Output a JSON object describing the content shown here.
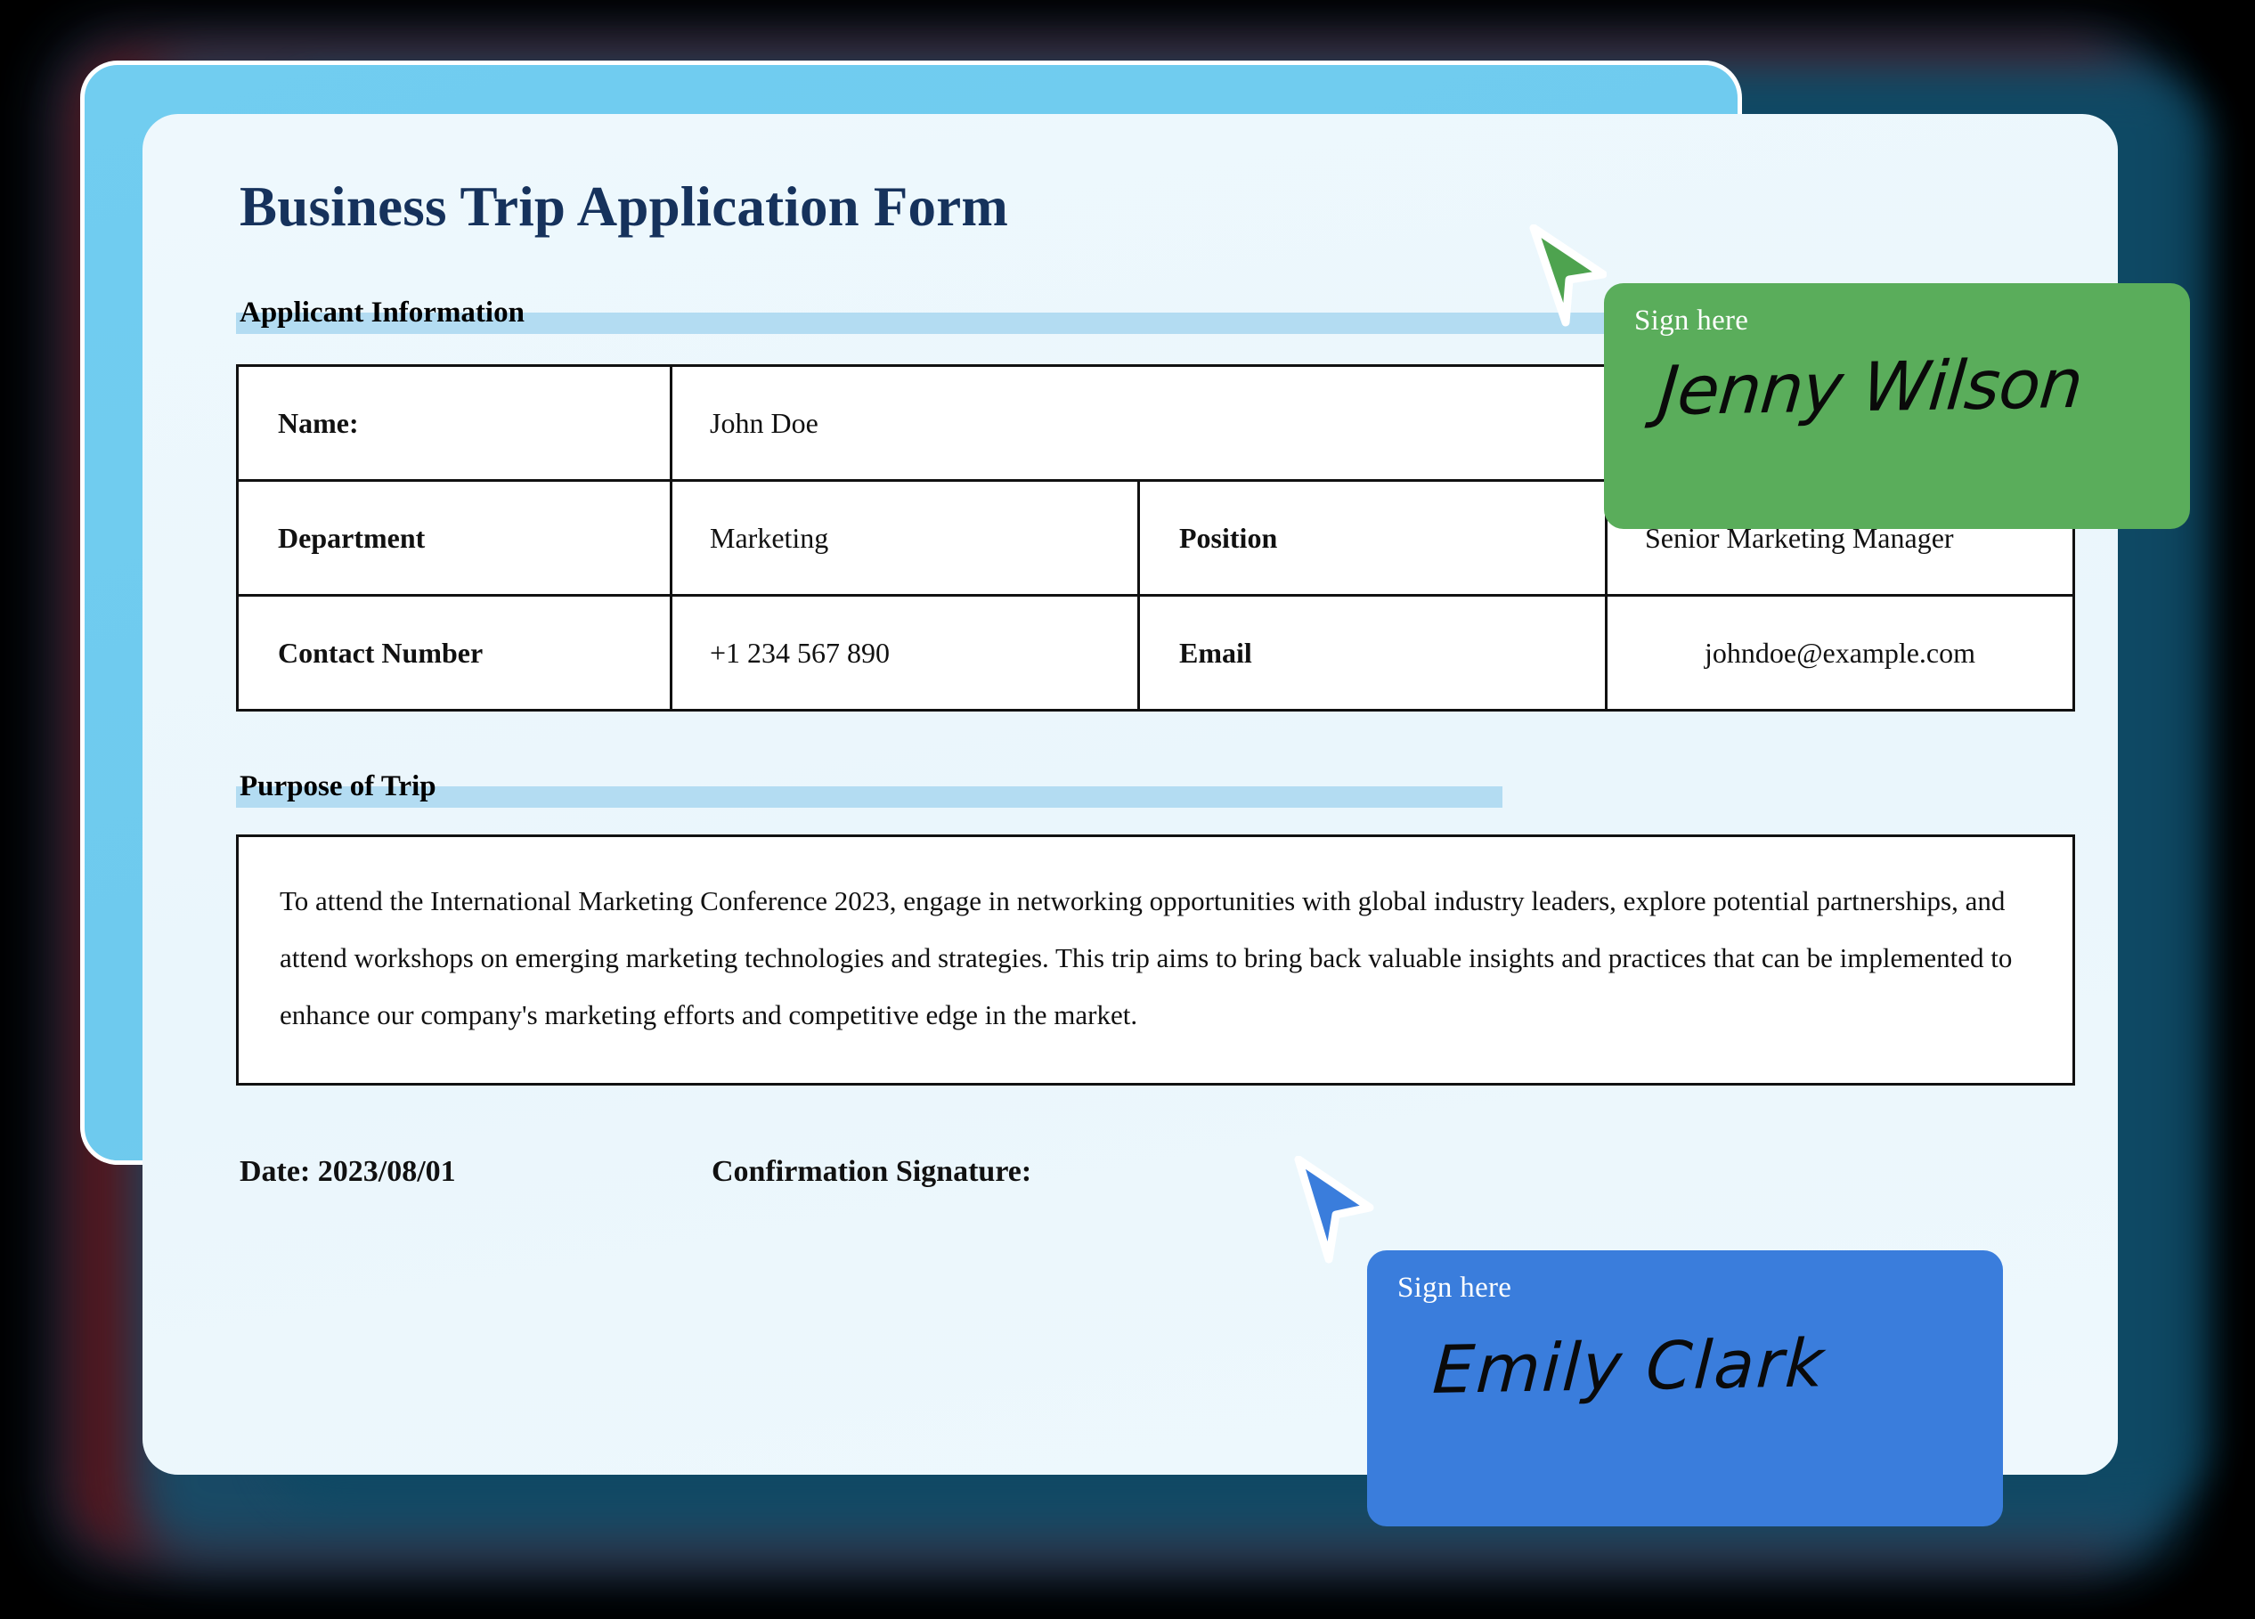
{
  "document": {
    "title": "Business Trip Application Form",
    "sections": {
      "applicant": "Applicant Information",
      "purpose": "Purpose of Trip"
    },
    "table": {
      "rows": [
        {
          "cells": [
            {
              "text": "Name:",
              "type": "label"
            },
            {
              "text": "John Doe",
              "type": "value"
            }
          ]
        },
        {
          "cells": [
            {
              "text": "Department",
              "type": "label"
            },
            {
              "text": "Marketing",
              "type": "value"
            },
            {
              "text": "Position",
              "type": "label"
            },
            {
              "text": "Senior Marketing Manager",
              "type": "value"
            }
          ]
        },
        {
          "cells": [
            {
              "text": "Contact Number",
              "type": "label"
            },
            {
              "text": "+1 234 567 890",
              "type": "value"
            },
            {
              "text": "Email",
              "type": "label"
            },
            {
              "text": "johndoe@example.com",
              "type": "value"
            }
          ]
        }
      ]
    },
    "purpose_text": "To attend the International Marketing Conference 2023, engage in networking opportunities with global industry leaders, explore potential partnerships, and attend workshops on emerging marketing technologies and strategies. This trip aims to bring back valuable insights and practices that can be implemented to enhance our company's marketing efforts and competitive edge in the market.",
    "footer": {
      "date_label": "Date: 2023/08/01",
      "signature_label": "Confirmation Signature:"
    }
  },
  "signature_popups": [
    {
      "id": "green",
      "prompt": "Sign here",
      "name": "Jenny Wilson",
      "color": "#5aad5b",
      "cursor_color": "#4ea34f"
    },
    {
      "id": "blue",
      "prompt": "Sign here",
      "name": "Emily Clark",
      "color": "#3a7ddc",
      "cursor_color": "#3a7ddc"
    }
  ],
  "theme": {
    "background": "#000000",
    "back_card": "#6ecaee",
    "form_card": "#eaf6fc",
    "title_color": "#16325c",
    "section_bar": "#b3dcf2",
    "glow_maroon": "#5c1116",
    "glow_navy": "#1d3550",
    "glow_teal": "#12506e"
  }
}
